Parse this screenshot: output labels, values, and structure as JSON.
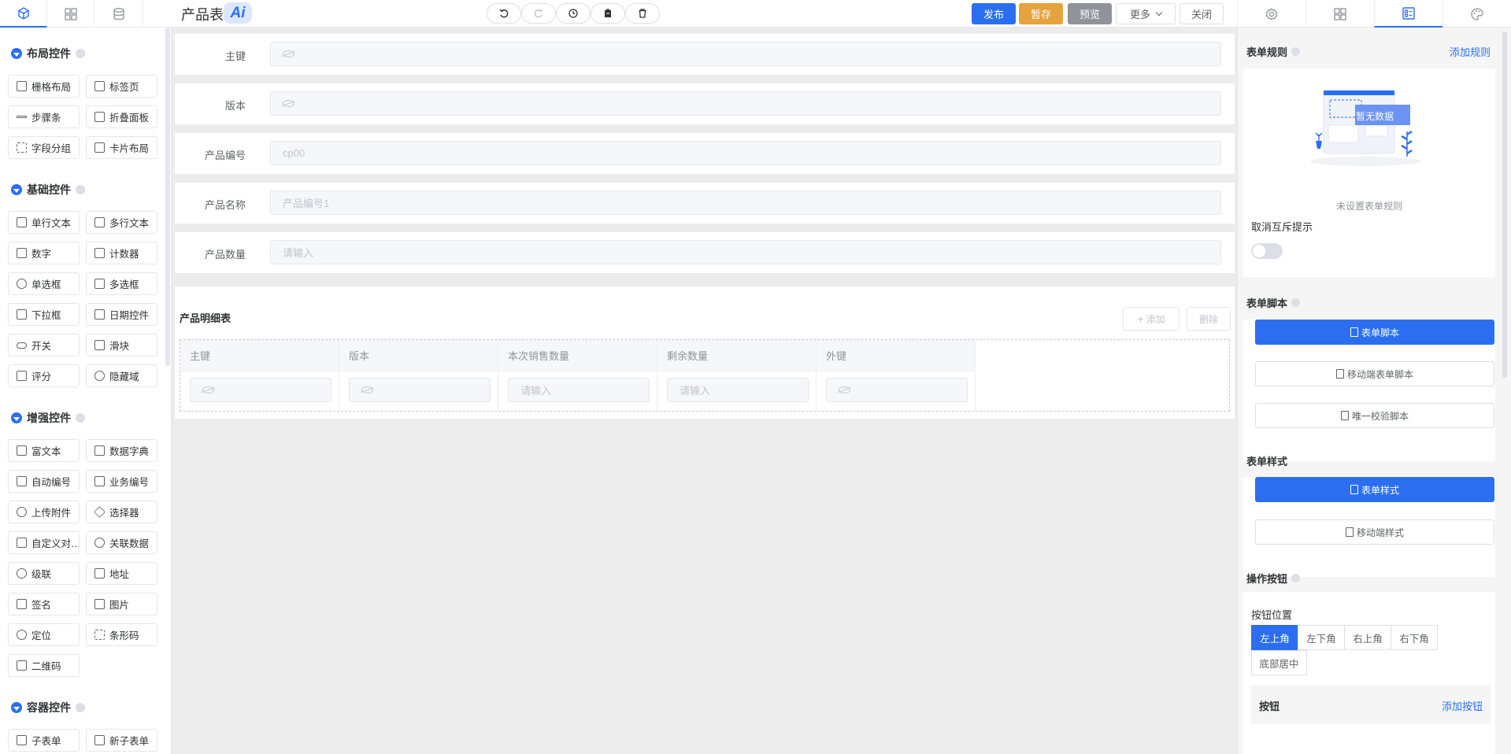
{
  "left_tabs": [
    {
      "icon": "cube-icon"
    },
    {
      "icon": "grid-icon"
    },
    {
      "icon": "database-icon"
    }
  ],
  "title": "产品表",
  "ai_badge": "Ai",
  "tools": [
    {
      "icon": "undo-icon"
    },
    {
      "icon": "redo-icon"
    },
    {
      "icon": "history-icon"
    },
    {
      "icon": "clipboard-icon"
    },
    {
      "icon": "trash-icon"
    }
  ],
  "actions": {
    "publish": "发布",
    "save_draft": "暂存",
    "preview": "预览",
    "more": "更多",
    "close": "关闭"
  },
  "colors": {
    "primary": "#2b6ff0",
    "warning": "#e6a23c",
    "info": "#909399"
  },
  "right_tabs": [
    {
      "icon": "gear-icon"
    },
    {
      "icon": "grid-icon"
    },
    {
      "icon": "form-icon"
    },
    {
      "icon": "palette-icon"
    }
  ],
  "palette": {
    "layout": {
      "title": "布局控件",
      "items": [
        "栅格布局",
        "标签页",
        "步骤条",
        "折叠面板",
        "字段分组",
        "卡片布局"
      ]
    },
    "basic": {
      "title": "基础控件",
      "items": [
        "单行文本",
        "多行文本",
        "数字",
        "计数器",
        "单选框",
        "多选框",
        "下拉框",
        "日期控件",
        "开关",
        "滑块",
        "评分",
        "隐藏域"
      ]
    },
    "enhanced": {
      "title": "增强控件",
      "items": [
        "富文本",
        "数据字典",
        "自动编号",
        "业务编号",
        "上传附件",
        "选择器",
        "自定义对…",
        "关联数据",
        "级联",
        "地址",
        "签名",
        "图片",
        "定位",
        "条形码",
        "二维码"
      ]
    },
    "container": {
      "title": "容器控件",
      "items": [
        "子表单",
        "新子表单"
      ]
    }
  },
  "form": {
    "fields": [
      {
        "label": "主键",
        "value": "",
        "hidden": true
      },
      {
        "label": "版本",
        "value": "",
        "hidden": true
      },
      {
        "label": "产品编号",
        "value": "cp00",
        "hidden": false
      },
      {
        "label": "产品名称",
        "value": "产品编号1",
        "hidden": false
      },
      {
        "label": "产品数量",
        "value": "请输入",
        "hidden": false
      }
    ],
    "subform": {
      "title": "产品明细表",
      "add": "添加",
      "delete": "删除",
      "columns": [
        {
          "header": "主键",
          "cell": "",
          "hidden": true
        },
        {
          "header": "版本",
          "cell": "",
          "hidden": true
        },
        {
          "header": "本次销售数量",
          "cell": "请输入",
          "hidden": false
        },
        {
          "header": "剩余数量",
          "cell": "请输入",
          "hidden": false
        },
        {
          "header": "外键",
          "cell": "",
          "hidden": true
        }
      ]
    }
  },
  "panel": {
    "rules_title": "表单规则",
    "add_rule": "添加规则",
    "empty_badge": "暂无数据",
    "empty_text": "未设置表单规则",
    "mutex_label": "取消互斥提示",
    "mutex_on": false,
    "script_title": "表单脚本",
    "script_buttons": [
      "表单脚本",
      "移动端表单脚本",
      "唯一校验脚本"
    ],
    "style_title": "表单样式",
    "style_buttons": [
      "表单样式",
      "移动端样式"
    ],
    "ops_title": "操作按钮",
    "position_label": "按钮位置",
    "positions": [
      "左上角",
      "左下角",
      "右上角",
      "右下角",
      "底部居中"
    ],
    "selected_position": "左上角",
    "buttons_label": "按钮",
    "add_button": "添加按钮"
  }
}
